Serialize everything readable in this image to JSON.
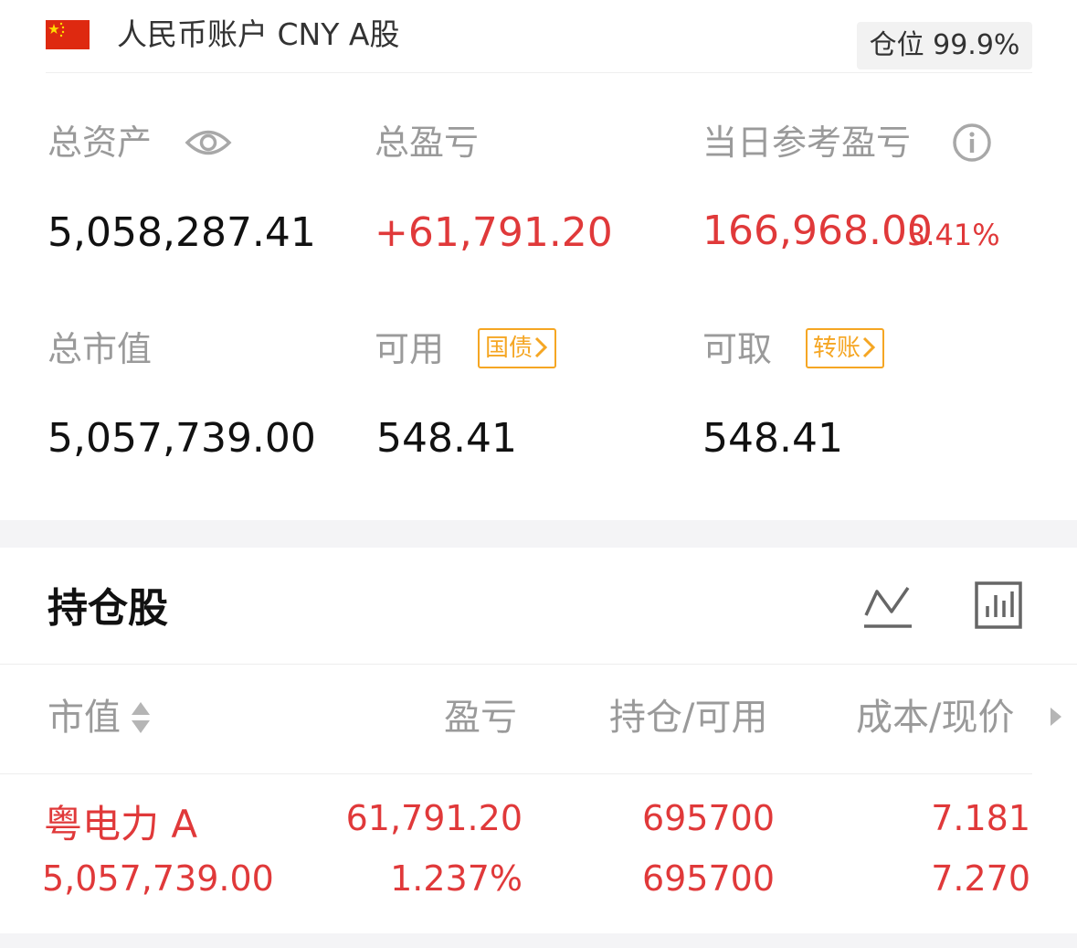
{
  "header": {
    "account_title": "人民币账户 CNY A股",
    "position_label": "仓位 99.9%"
  },
  "summary": {
    "total_assets_label": "总资产",
    "total_assets_value": "5,058,287.41",
    "total_pnl_label": "总盈亏",
    "total_pnl_value": "+61,791.20",
    "day_pnl_label": "当日参考盈亏",
    "day_pnl_value": "166,968.00",
    "day_pnl_pct": "3.41%",
    "market_value_label": "总市值",
    "market_value_value": "5,057,739.00",
    "available_label": "可用",
    "available_tag": "国债",
    "available_value": "548.41",
    "withdrawable_label": "可取",
    "withdrawable_tag": "转账",
    "withdrawable_value": "548.41"
  },
  "holdings": {
    "title": "持仓股",
    "columns": [
      "市值",
      "盈亏",
      "持仓/可用",
      "成本/现价"
    ],
    "rows": [
      {
        "name": "粤电力 A",
        "market_value": "5,057,739.00",
        "pnl": "61,791.20",
        "pnl_pct": "1.237%",
        "position": "695700",
        "available": "695700",
        "cost": "7.181",
        "price": "7.270"
      }
    ]
  },
  "colors": {
    "profit_red": "#e0393a",
    "tag_orange": "#f5a623",
    "label_gray": "#9a9a9a",
    "flag_red": "#de2910",
    "flag_star": "#ffde00"
  },
  "icons": [
    "china-flag-icon",
    "eye-icon",
    "info-icon",
    "chevron-right-icon",
    "line-chart-icon",
    "bar-chart-icon",
    "sort-icon",
    "scroll-right-icon"
  ]
}
